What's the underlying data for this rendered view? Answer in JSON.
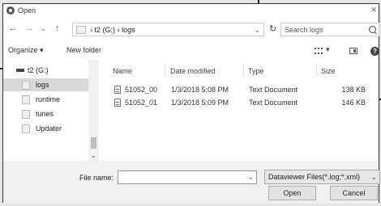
{
  "window": {
    "title": "Open"
  },
  "nav": {
    "back": "←",
    "forward": "→",
    "up": "↑",
    "breadcrumb": [
      "t2 (G:)",
      "logs"
    ],
    "separator": "›",
    "search_placeholder": "Search logs"
  },
  "toolbar": {
    "organize": "Organize ▾",
    "new_folder": "New folder"
  },
  "sidebar": {
    "items": [
      {
        "label": "t2 (G:)",
        "icon": "drive-icon"
      },
      {
        "label": "logs",
        "icon": "folder-icon",
        "selected": true
      },
      {
        "label": "runtime",
        "icon": "folder-icon"
      },
      {
        "label": "tunes",
        "icon": "folder-icon"
      },
      {
        "label": "Updater",
        "icon": "folder-icon"
      }
    ]
  },
  "files": {
    "columns": [
      "Name",
      "Date modified",
      "Type",
      "Size"
    ],
    "rows": [
      {
        "name": "51052_00",
        "date": "1/3/2018 5:08 PM",
        "type": "Text Document",
        "size": "138 KB"
      },
      {
        "name": "51052_01",
        "date": "1/3/2018 5:09 PM",
        "type": "Text Document",
        "size": "146 KB"
      }
    ]
  },
  "footer": {
    "file_name_label": "File name:",
    "file_name_value": "",
    "filter": "Dataviewer Files(*.log;*.xml)",
    "open": "Open",
    "cancel": "Cancel"
  }
}
